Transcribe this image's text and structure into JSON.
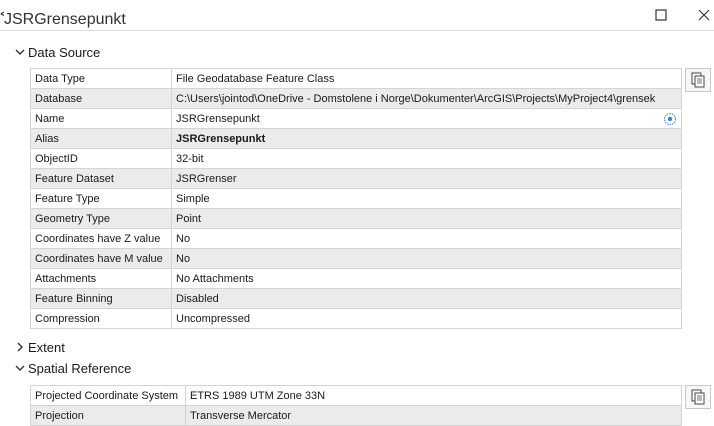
{
  "window": {
    "title": "JSRGrensepunkt",
    "title_prefix": "<"
  },
  "sections": {
    "data_source": {
      "label": "Data Source",
      "expanded": true,
      "rows": [
        {
          "label": "Data Type",
          "value": "File Geodatabase Feature Class"
        },
        {
          "label": "Database",
          "value": "C:\\Users\\jointod\\OneDrive - Domstolene i Norge\\Dokumenter\\ArcGIS\\Projects\\MyProject4\\grensek"
        },
        {
          "label": "Name",
          "value": "JSRGrensepunkt"
        },
        {
          "label": "Alias",
          "value": "JSRGrensepunkt"
        },
        {
          "label": "ObjectID",
          "value": "32-bit"
        },
        {
          "label": "Feature Dataset",
          "value": "JSRGrenser"
        },
        {
          "label": "Feature Type",
          "value": "Simple"
        },
        {
          "label": "Geometry Type",
          "value": "Point"
        },
        {
          "label": "Coordinates have Z value",
          "value": "No"
        },
        {
          "label": "Coordinates have M value",
          "value": "No"
        },
        {
          "label": "Attachments",
          "value": "No Attachments"
        },
        {
          "label": "Feature Binning",
          "value": "Disabled"
        },
        {
          "label": "Compression",
          "value": "Uncompressed"
        }
      ]
    },
    "extent": {
      "label": "Extent",
      "expanded": false
    },
    "spatial_reference": {
      "label": "Spatial Reference",
      "expanded": true,
      "rows": [
        {
          "label": "Projected Coordinate System",
          "value": "ETRS 1989 UTM Zone 33N"
        },
        {
          "label": "Projection",
          "value": "Transverse Mercator"
        }
      ]
    }
  },
  "icons": {
    "maximize": "maximize-icon",
    "close": "close-icon",
    "copy": "copy-icon",
    "name_info": "info-icon"
  },
  "colors": {
    "alt_row": "#ebebeb",
    "border": "#d4d4d4",
    "icon_blue": "#3a7bd5"
  }
}
